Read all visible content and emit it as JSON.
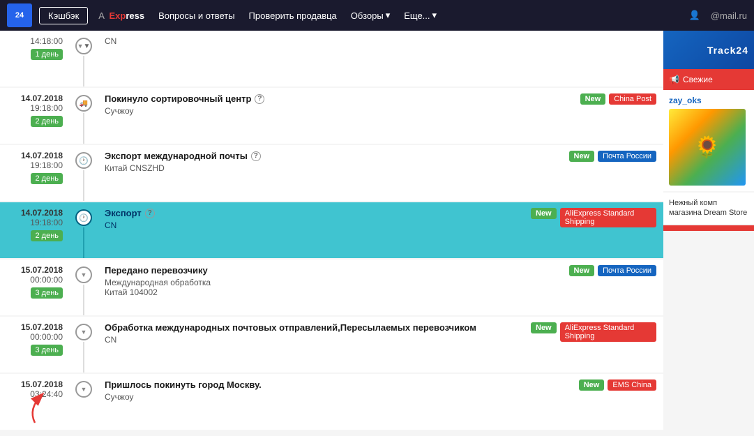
{
  "header": {
    "logo": "24",
    "cashback_label": "Кэшбэк",
    "express_a": "A",
    "express_exp": "Exp",
    "express_ress": "ress",
    "nav": [
      {
        "label": "Вопросы и ответы"
      },
      {
        "label": "Проверить продавца"
      },
      {
        "label": "Обзоры",
        "dropdown": true
      },
      {
        "label": "Еще...",
        "dropdown": true
      }
    ],
    "user_icon": "👤",
    "user_email": "@mail.ru"
  },
  "timeline": {
    "items": [
      {
        "id": "item-top-partial",
        "date": "14:18:00",
        "day": "1 день",
        "location": "CN",
        "icon": "arrow-down",
        "highlighted": false,
        "show_date_top": "",
        "title": "",
        "subtitle": "CN",
        "badges": []
      },
      {
        "id": "item-1",
        "date_top": "14.07.2018",
        "date": "19:18:00",
        "day": "2 день",
        "icon": "truck",
        "highlighted": false,
        "title": "Покинуло сортировочный центр",
        "has_help": true,
        "subtitle": "Сучжоу",
        "badges": [
          {
            "type": "new",
            "label": "New"
          },
          {
            "type": "china-post",
            "label": "China Post"
          }
        ]
      },
      {
        "id": "item-2",
        "date_top": "14.07.2018",
        "date": "19:18:00",
        "day": "2 день",
        "icon": "clock",
        "highlighted": false,
        "title": "Экспорт международной почты",
        "has_help": true,
        "subtitle": "Китай CNSZHD",
        "badges": [
          {
            "type": "new",
            "label": "New"
          },
          {
            "type": "pochta",
            "label": "Почта России"
          }
        ]
      },
      {
        "id": "item-3",
        "date_top": "14.07.2018",
        "date": "19:18:00",
        "day": "2 день",
        "icon": "clock",
        "highlighted": true,
        "title": "Экспорт",
        "has_help": true,
        "subtitle": "CN",
        "badges": [
          {
            "type": "new",
            "label": "New"
          },
          {
            "type": "aliexpress",
            "label": "AliExpress Standard Shipping"
          }
        ]
      },
      {
        "id": "item-4",
        "date_top": "15.07.2018",
        "date": "00:00:00",
        "day": "3 день",
        "icon": "arrow-down",
        "highlighted": false,
        "title": "Передано перевозчику",
        "has_help": false,
        "subtitle": "Международная обработка\nКитай 104002",
        "subtitle_line1": "Международная обработка",
        "subtitle_line2": "Китай 104002",
        "badges": [
          {
            "type": "new",
            "label": "New"
          },
          {
            "type": "pochta",
            "label": "Почта России"
          }
        ]
      },
      {
        "id": "item-5",
        "date_top": "15.07.2018",
        "date": "00:00:00",
        "day": "3 день",
        "icon": "arrow-down",
        "highlighted": false,
        "title": "Обработка международных почтовых отправлений,Пересылаемых перевозчиком",
        "has_help": false,
        "subtitle": "CN",
        "badges": [
          {
            "type": "new",
            "label": "New"
          },
          {
            "type": "aliexpress",
            "label": "AliExpress Standard Shipping"
          }
        ]
      },
      {
        "id": "item-6",
        "date_top": "15.07.2018",
        "date": "03:24:40",
        "day": "",
        "icon": "arrow-down",
        "highlighted": false,
        "title": "Пришлось покинуть город Москву.",
        "has_help": false,
        "subtitle": "Сучжоу",
        "badges": [
          {
            "type": "new",
            "label": "New"
          },
          {
            "type": "ems",
            "label": "EMS China"
          }
        ]
      }
    ]
  },
  "sidebar": {
    "track24_label": "Track24",
    "fresh_label": "Свежие",
    "username": "zay_oks",
    "product_title": "Нежный комп\nмагазина Dream\nStore"
  }
}
